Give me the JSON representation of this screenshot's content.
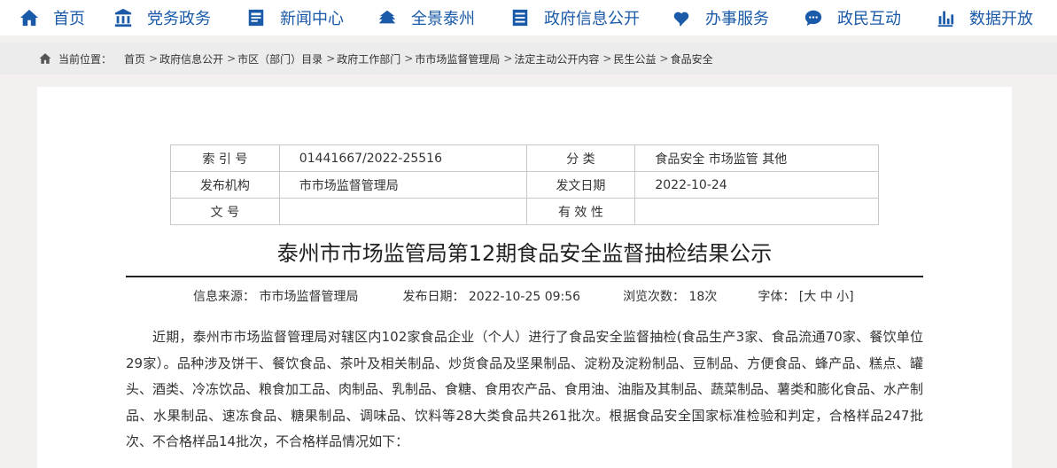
{
  "nav": {
    "items": [
      {
        "label": "首页",
        "icon": "home-icon"
      },
      {
        "label": "党务政务",
        "icon": "building-icon"
      },
      {
        "label": "新闻中心",
        "icon": "newspaper-icon"
      },
      {
        "label": "全景泰州",
        "icon": "landscape-icon"
      },
      {
        "label": "政府信息公开",
        "icon": "list-icon"
      },
      {
        "label": "办事服务",
        "icon": "service-icon"
      },
      {
        "label": "政民互动",
        "icon": "chat-icon"
      },
      {
        "label": "数据开放",
        "icon": "bar-chart-icon"
      }
    ]
  },
  "breadcrumb": {
    "label": "当前位置：",
    "items": [
      "首页",
      "政府信息公开",
      "市区（部门）目录",
      "政府工作部门",
      "市市场监督管理局",
      "法定主动公开内容",
      "民生公益",
      "食品安全"
    ]
  },
  "meta": {
    "index_label": "索 引 号",
    "index_value": "01441667/2022-25516",
    "category_label": "分 类",
    "category_value": "食品安全 市场监管 其他",
    "publisher_label": "发布机构",
    "publisher_value": "市市场监督管理局",
    "issue_date_label": "发文日期",
    "issue_date_value": "2022-10-24",
    "doc_no_label": "文 号",
    "doc_no_value": "",
    "validity_label": "有 效 性",
    "validity_value": ""
  },
  "article": {
    "title": "泰州市市场监管局第12期食品安全监督抽检结果公示",
    "source": "信息来源：  市市场监督管理局",
    "publish_time": "发布日期：  2022-10-25 09:56",
    "views": "浏览次数：  18次",
    "font_label": "字体：",
    "font_open": "[",
    "font_large": "大",
    "font_medium": "中",
    "font_small": "小",
    "font_close": "]",
    "body": "近期，泰州市市场监督管理局对辖区内102家食品企业（个人）进行了食品安全监督抽检(食品生产3家、食品流通70家、餐饮单位29家）。品种涉及饼干、餐饮食品、茶叶及相关制品、炒货食品及坚果制品、淀粉及淀粉制品、豆制品、方便食品、蜂产品、糕点、罐头、酒类、冷冻饮品、粮食加工品、肉制品、乳制品、食糖、食用农产品、食用油、油脂及其制品、蔬菜制品、薯类和膨化食品、水产制品、水果制品、速冻食品、糖果制品、调味品、饮料等28大类食品共261批次。根据食品安全国家标准检验和判定，合格样品247批次、不合格样品14批次，不合格样品情况如下："
  }
}
